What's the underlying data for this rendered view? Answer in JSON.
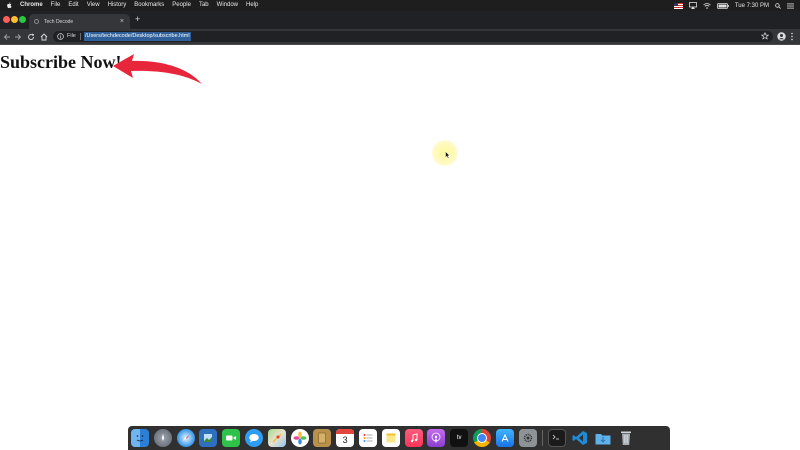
{
  "menubar": {
    "app_name": "Chrome",
    "items": [
      "File",
      "Edit",
      "View",
      "History",
      "Bookmarks",
      "People",
      "Tab",
      "Window",
      "Help"
    ],
    "clock": "Tue 7:30 PM"
  },
  "browser": {
    "tab_title": "Tech Decode",
    "tab_close": "×",
    "new_tab": "+",
    "scheme_label": "File",
    "url": "/Users/techdecode/Desktop/subscribe.html"
  },
  "page": {
    "heading": "Subscribe Now!"
  },
  "dock": {
    "icons": [
      "finder-icon",
      "launchpad-icon",
      "safari-icon",
      "preview-icon",
      "facetime-icon",
      "messages-icon",
      "maps-icon",
      "photos-icon",
      "notes-book-icon",
      "calendar-icon",
      "reminders-icon",
      "stickies-icon",
      "music-icon",
      "podcasts-icon",
      "apple-tv-icon",
      "chrome-icon",
      "app-store-icon",
      "system-preferences-icon",
      "terminal-icon",
      "vscode-icon",
      "downloads-folder-icon",
      "trash-icon"
    ],
    "calendar_day": "3",
    "tv_label": "tv"
  },
  "colors": {
    "accent_arrow": "#e8263b",
    "url_highlight": "#2f5f99",
    "titlebar": "#202124",
    "toolbar": "#35363a"
  }
}
